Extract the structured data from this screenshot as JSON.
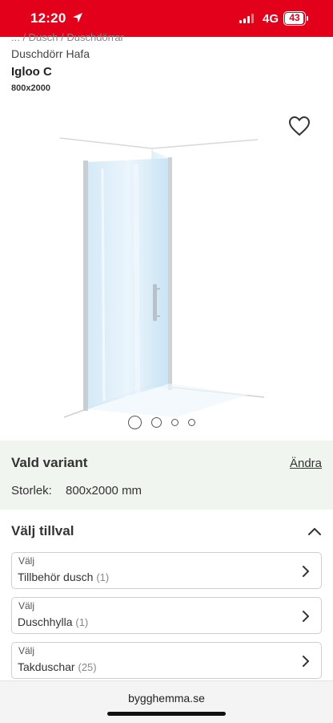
{
  "status_bar": {
    "time": "12:20",
    "network": "4G",
    "battery": "43",
    "accent_color": "#e3001b"
  },
  "breadcrumb": "... / Dusch / Duschdörrar",
  "product": {
    "brand": "Duschdörr Hafa",
    "title": "Igloo C",
    "size": "800x2000",
    "favorite_icon": "heart-icon"
  },
  "gallery": {
    "image_count": 4,
    "active_index": 0
  },
  "variant": {
    "title": "Vald variant",
    "change_link": "Ändra",
    "size_label": "Storlek:",
    "size_value": "800x2000 mm",
    "background": "#f1f5f0"
  },
  "addons": {
    "title": "Välj tillval",
    "items": [
      {
        "label": "Välj",
        "name": "Tillbehör dusch",
        "count": "(1)"
      },
      {
        "label": "Välj",
        "name": "Duschhylla",
        "count": "(1)"
      },
      {
        "label": "Välj",
        "name": "Takduschar",
        "count": "(25)"
      }
    ]
  },
  "browser": {
    "domain": "bygghemma.se"
  }
}
